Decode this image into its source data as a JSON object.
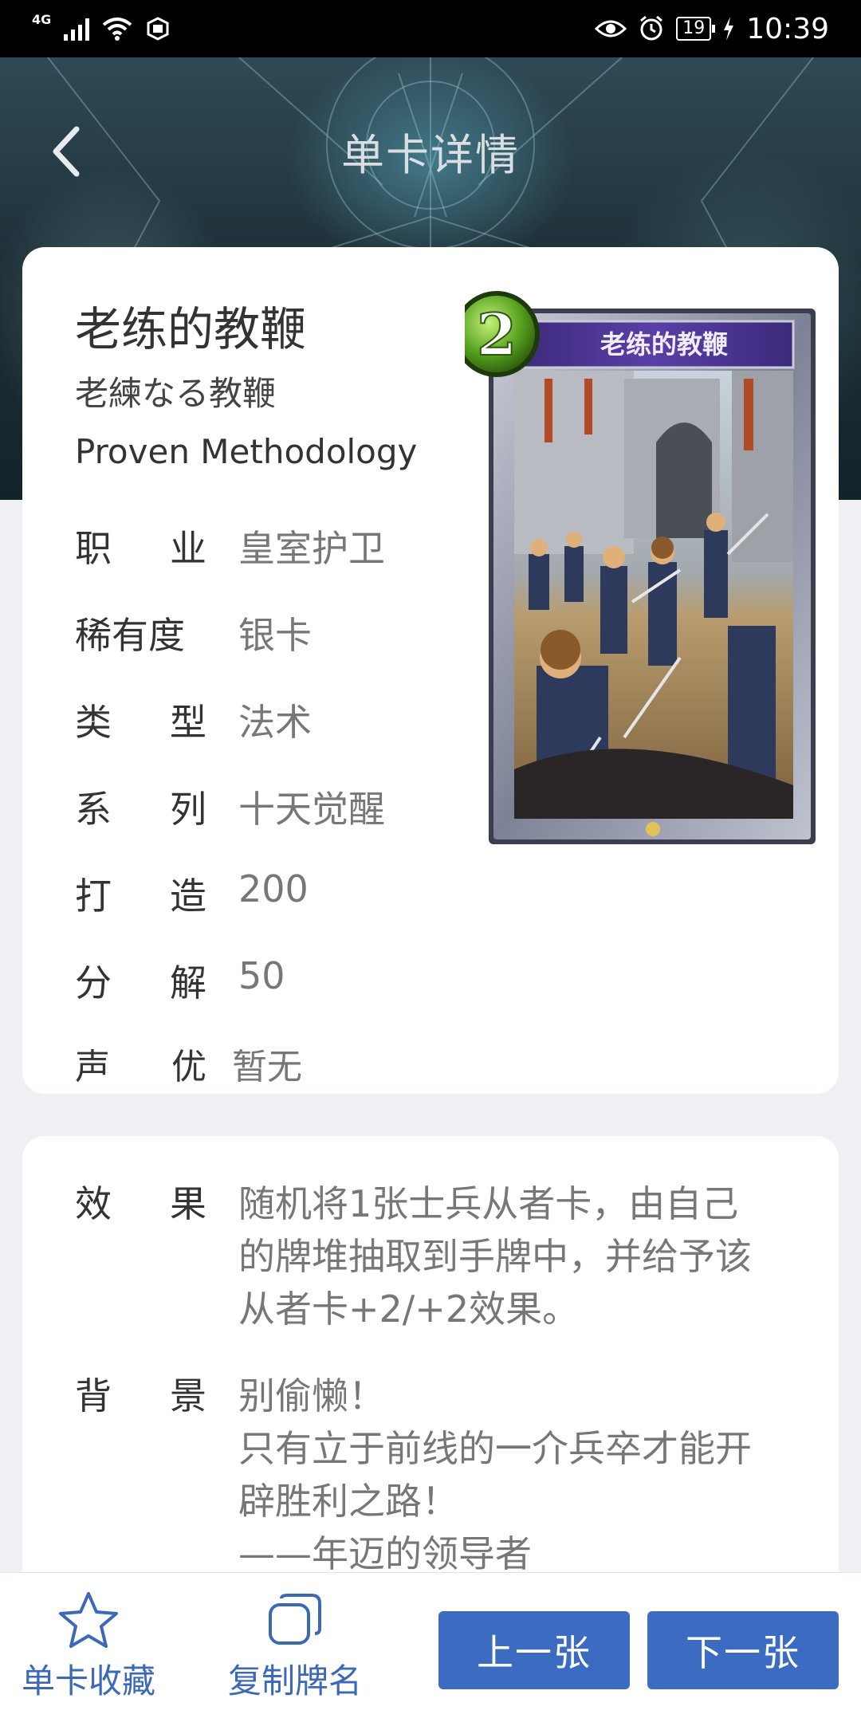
{
  "status_bar": {
    "network": "4G",
    "battery": "19",
    "time": "10:39"
  },
  "header": {
    "title": "单卡详情"
  },
  "card": {
    "name_cn": "老练的教鞭",
    "name_jp": "老練なる教鞭",
    "name_en": "Proven Methodology",
    "cost": "2",
    "art_title": "老练的教鞭",
    "attributes": [
      {
        "key": [
          "职",
          "业"
        ],
        "value": "皇室护卫"
      },
      {
        "key": [
          "稀有度"
        ],
        "value": "银卡"
      },
      {
        "key": [
          "类",
          "型"
        ],
        "value": "法术"
      },
      {
        "key": [
          "系",
          "列"
        ],
        "value": "十天觉醒"
      },
      {
        "key": [
          "打",
          "造"
        ],
        "value": "200"
      },
      {
        "key": [
          "分",
          "解"
        ],
        "value": "50"
      },
      {
        "key": [
          "声",
          "优"
        ],
        "value": "暂无"
      }
    ]
  },
  "effect": {
    "effect_key": [
      "效",
      "果"
    ],
    "effect_text": "随机将1张士兵从者卡，由自己\n的牌堆抽取到手牌中，并给予该\n从者卡+2/+2效果。",
    "background_key": [
      "背",
      "景"
    ],
    "background_text": "别偷懒！\n只有立于前线的一介兵卒才能开\n辟胜利之路！\n——年迈的领导者"
  },
  "bottom_bar": {
    "favorite_label": "单卡收藏",
    "copy_label": "复制牌名",
    "prev_label": "上一张",
    "next_label": "下一张"
  },
  "colors": {
    "accent": "#3b6cc1",
    "text_primary": "#333333",
    "text_secondary": "#777777"
  },
  "icons": {
    "back": "chevron-left-icon",
    "favorite": "star-outline-icon",
    "copy": "copy-icon"
  }
}
